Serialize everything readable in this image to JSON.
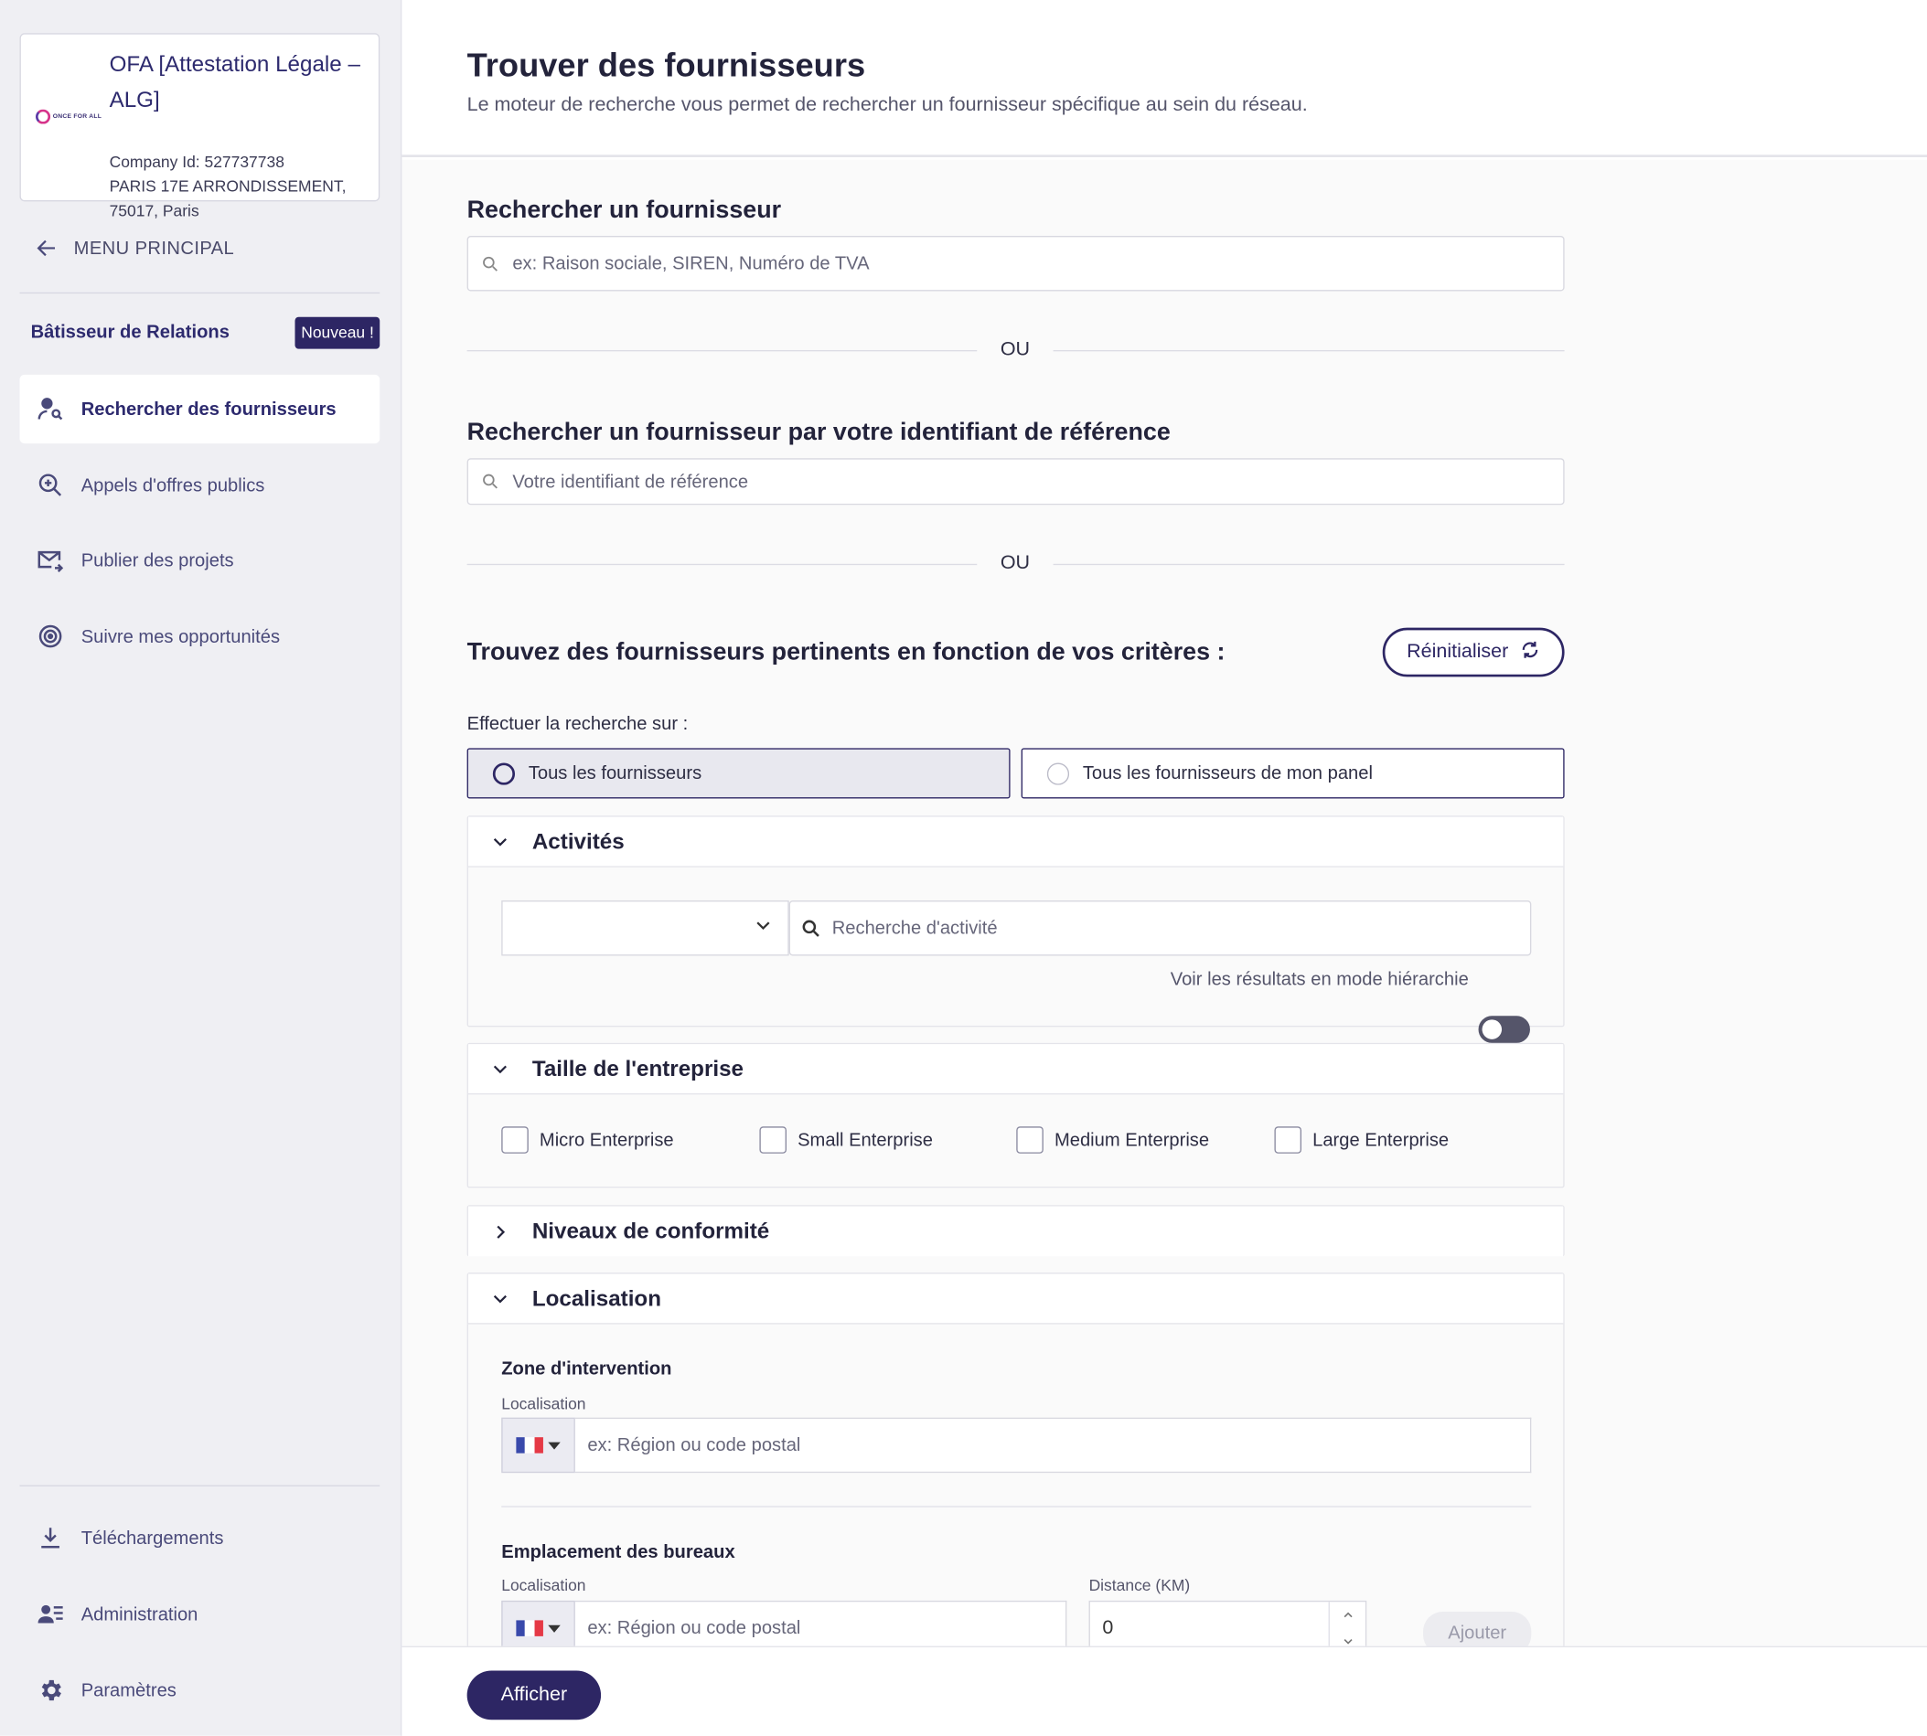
{
  "sidebar": {
    "company": {
      "logo_text": "ONCE FOR ALL",
      "name": "OFA [Attestation Légale – ALG]",
      "company_id": "Company Id: 527737738",
      "address_line1": "PARIS 17E ARRONDISSEMENT,",
      "address_line2": "75017, Paris"
    },
    "back_label": "MENU PRINCIPAL",
    "section_title": "Bâtisseur de Relations",
    "badge": "Nouveau !",
    "items": [
      {
        "label": "Rechercher des fournisseurs",
        "icon": "user-search-icon"
      },
      {
        "label": "Appels d'offres publics",
        "icon": "zoom-in-icon"
      },
      {
        "label": "Publier des projets",
        "icon": "mail-send-icon"
      },
      {
        "label": "Suivre mes opportunités",
        "icon": "target-icon"
      }
    ],
    "bottom_items": [
      {
        "label": "Téléchargements",
        "icon": "download-icon"
      },
      {
        "label": "Administration",
        "icon": "users-list-icon"
      },
      {
        "label": "Paramètres",
        "icon": "gear-icon"
      }
    ]
  },
  "header": {
    "title": "Trouver des fournisseurs",
    "subtitle": "Le moteur de recherche vous permet de rechercher un fournisseur spécifique au sein du réseau."
  },
  "search_supplier": {
    "title": "Rechercher un fournisseur",
    "placeholder": "ex: Raison sociale, SIREN, Numéro de TVA"
  },
  "or_label": "OU",
  "search_reference": {
    "title": "Rechercher un fournisseur par votre identifiant de référence",
    "placeholder": "Votre identifiant de référence"
  },
  "criteria": {
    "title": "Trouvez des fournisseurs pertinents en fonction de vos critères :",
    "reset_label": "Réinitialiser",
    "search_on_label": "Effectuer la recherche sur :",
    "options": [
      "Tous les fournisseurs",
      "Tous les fournisseurs de mon panel"
    ],
    "selected_option": "Tous les fournisseurs"
  },
  "activities": {
    "title": "Activités",
    "search_placeholder": "Recherche d'activité",
    "hierarchy_label": "Voir les résultats en mode hiérarchie",
    "hierarchy_on": false
  },
  "company_size": {
    "title": "Taille de l'entreprise",
    "options": [
      "Micro Enterprise",
      "Small Enterprise",
      "Medium Enterprise",
      "Large Enterprise"
    ]
  },
  "compliance": {
    "title": "Niveaux de conformité"
  },
  "location": {
    "title": "Localisation",
    "zone_title": "Zone d'intervention",
    "zone_label": "Localisation",
    "zone_placeholder": "ex: Région ou code postal",
    "office_title": "Emplacement des bureaux",
    "office_label": "Localisation",
    "office_placeholder": "ex: Région ou code postal",
    "distance_label": "Distance (KM)",
    "distance_value": "0",
    "add_label": "Ajouter"
  },
  "footer": {
    "show_label": "Afficher"
  },
  "colors": {
    "accent": "#2d2664",
    "sidebar_bg": "#efeff3",
    "flag_blue": "#3949ab",
    "flag_white": "#ffffff",
    "flag_red": "#e53946"
  }
}
